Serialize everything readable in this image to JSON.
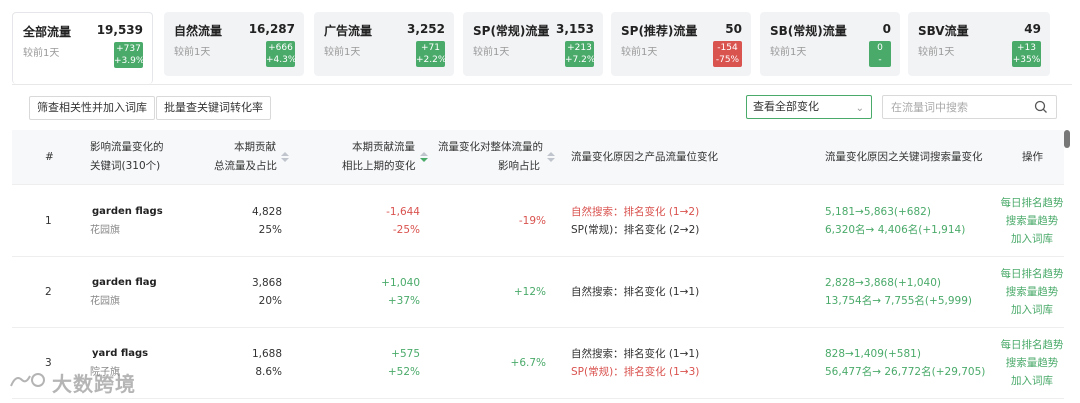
{
  "stats": [
    {
      "name": "全部流量",
      "value": "19,539",
      "sub": "较前1天",
      "delta": "+737",
      "pct": "+3.9%",
      "trend": "up"
    },
    {
      "name": "自然流量",
      "value": "16,287",
      "sub": "较前1天",
      "delta": "+666",
      "pct": "+4.3%",
      "trend": "up"
    },
    {
      "name": "广告流量",
      "value": "3,252",
      "sub": "较前1天",
      "delta": "+71",
      "pct": "+2.2%",
      "trend": "up"
    },
    {
      "name": "SP(常规)流量",
      "value": "3,153",
      "sub": "较前1天",
      "delta": "+213",
      "pct": "+7.2%",
      "trend": "up"
    },
    {
      "name": "SP(推荐)流量",
      "value": "50",
      "sub": "较前1天",
      "delta": "-154",
      "pct": "-75%",
      "trend": "down"
    },
    {
      "name": "SB(常规)流量",
      "value": "0",
      "sub": "较前1天",
      "delta": "0",
      "pct": "-",
      "trend": "up"
    },
    {
      "name": "SBV流量",
      "value": "49",
      "sub": "较前1天",
      "delta": "+13",
      "pct": "+35%",
      "trend": "up"
    }
  ],
  "toolbar": {
    "filter_btn": "筛查相关性并加入词库",
    "batch_btn": "批量查关键词转化率",
    "select_value": "查看全部变化",
    "search_placeholder": "在流量词中搜索"
  },
  "table": {
    "headers": {
      "index": "#",
      "keyword_l1": "影响流量变化的",
      "keyword_l2": "关键词(310个)",
      "contrib_l1": "本期贡献",
      "contrib_l2": "总流量及占比",
      "change_l1": "本期贡献流量",
      "change_l2": "相比上期的变化",
      "impact_l1": "流量变化对整体流量的",
      "impact_l2": "影响占比",
      "reason_product": "流量变化原因之产品流量位变化",
      "reason_keyword": "流量变化原因之关键词搜索量变化",
      "action": "操作"
    },
    "rows": [
      {
        "index": "1",
        "keyword": "garden flags",
        "keyword_cn": "花园旗",
        "traffic": "4,828",
        "share": "25%",
        "change": "-1,644",
        "change_pct": "-25%",
        "change_trend": "neg",
        "impact": "-19%",
        "impact_trend": "neg",
        "reason1": "自然搜索：排名变化 (1→2)",
        "reason1_red": true,
        "reason2": "SP(常规)：排名变化 (2→2)",
        "reason2_red": false,
        "kw1": "5,181→5,863(+682)",
        "kw2": "6,320名→ 4,406名(+1,914)",
        "action1": "每日排名趋势",
        "action2": "搜索量趋势",
        "action3": "加入词库"
      },
      {
        "index": "2",
        "keyword": "garden flag",
        "keyword_cn": "花园旗",
        "traffic": "3,868",
        "share": "20%",
        "change": "+1,040",
        "change_pct": "+37%",
        "change_trend": "pos",
        "impact": "+12%",
        "impact_trend": "pos",
        "reason1": "自然搜索：排名变化 (1→1)",
        "reason1_red": false,
        "reason2": "",
        "reason2_red": false,
        "kw1": "2,828→3,868(+1,040)",
        "kw2": "13,754名→ 7,755名(+5,999)",
        "action1": "每日排名趋势",
        "action2": "搜索量趋势",
        "action3": "加入词库"
      },
      {
        "index": "3",
        "keyword": "yard flags",
        "keyword_cn": "院子旗",
        "traffic": "1,688",
        "share": "8.6%",
        "change": "+575",
        "change_pct": "+52%",
        "change_trend": "pos",
        "impact": "+6.7%",
        "impact_trend": "pos",
        "reason1": "自然搜索：排名变化 (1→1)",
        "reason1_red": false,
        "reason2": "SP(常规)：排名变化 (1→3)",
        "reason2_red": true,
        "kw1": "828→1,409(+581)",
        "kw2": "56,477名→ 26,772名(+29,705)",
        "action1": "每日排名趋势",
        "action2": "搜索量趋势",
        "action3": "加入词库"
      }
    ]
  },
  "watermark": "大数跨境",
  "colors": {
    "accent": "#4aaa6a",
    "negative": "#d9534f",
    "card_bg": "#f2f3f5"
  }
}
